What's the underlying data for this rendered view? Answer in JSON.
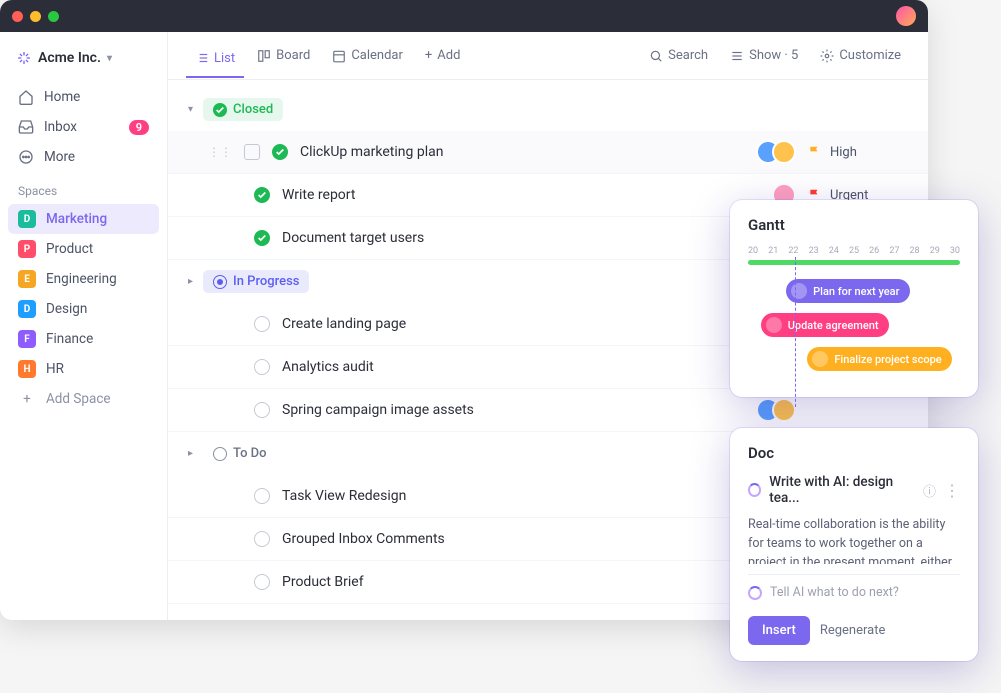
{
  "workspace": {
    "name": "Acme Inc."
  },
  "nav": {
    "home": "Home",
    "inbox": "Inbox",
    "inbox_badge": "9",
    "more": "More"
  },
  "spaces_label": "Spaces",
  "spaces": [
    {
      "letter": "D",
      "color": "#1abc9c",
      "label": "Marketing",
      "active": true
    },
    {
      "letter": "P",
      "color": "#ff4d6a",
      "label": "Product"
    },
    {
      "letter": "E",
      "color": "#f5a623",
      "label": "Engineering"
    },
    {
      "letter": "D",
      "color": "#1e9fff",
      "label": "Design"
    },
    {
      "letter": "F",
      "color": "#8e5cff",
      "label": "Finance"
    },
    {
      "letter": "H",
      "color": "#ff7a2f",
      "label": "HR"
    }
  ],
  "add_space": "Add Space",
  "toolbar": {
    "list": "List",
    "board": "Board",
    "calendar": "Calendar",
    "add": "Add",
    "search": "Search",
    "show": "Show · 5",
    "customize": "Customize"
  },
  "groups": {
    "closed": {
      "label": "Closed",
      "tasks": [
        {
          "name": "ClickUp marketing plan",
          "assignees": [
            "#5aa0ff",
            "#ffc34d"
          ],
          "priority": "High",
          "flag": "#ffb020",
          "highlighted": true,
          "showHandle": true
        },
        {
          "name": "Write report",
          "assignees": [
            "#ff9fbf"
          ],
          "priority": "Urgent",
          "flag": "#ff3b30"
        },
        {
          "name": "Document target users",
          "assignees": [
            "#f78fa0",
            "#ffc34d"
          ]
        }
      ]
    },
    "progress": {
      "label": "In Progress",
      "tasks": [
        {
          "name": "Create landing page",
          "assignees": [
            "#5aa0ff"
          ]
        },
        {
          "name": "Analytics audit",
          "assignees": [
            "#c95c5c",
            "#ffc34d"
          ]
        },
        {
          "name": "Spring campaign image assets",
          "assignees": [
            "#5aa0ff",
            "#ffc34d"
          ]
        }
      ]
    },
    "todo": {
      "label": "To Do",
      "tasks": [
        {
          "name": "Task View Redesign",
          "assignees": [
            "#ffc34d"
          ]
        },
        {
          "name": "Grouped Inbox Comments",
          "assignees": [
            "#f78fa0",
            "#ffc9b0"
          ]
        },
        {
          "name": "Product Brief",
          "assignees": [
            "#5ad0d0"
          ]
        }
      ]
    }
  },
  "gantt": {
    "title": "Gantt",
    "days": [
      "20",
      "21",
      "22",
      "23",
      "24",
      "25",
      "26",
      "27",
      "28",
      "29",
      "30"
    ],
    "bars": [
      {
        "label": "Plan for next year",
        "color": "#7b68ee",
        "offset": 18
      },
      {
        "label": "Update agreement",
        "color": "#ff3f81",
        "offset": 6
      },
      {
        "label": "Finalize project scope",
        "color": "#ffb020",
        "offset": 28
      }
    ]
  },
  "doc": {
    "title": "Doc",
    "subtitle": "Write with AI: design tea...",
    "body": "Real-time collaboration is the ability for teams to work together on a project in the present moment, either",
    "placeholder": "Tell AI what to do next?",
    "insert": "Insert",
    "regenerate": "Regenerate"
  }
}
